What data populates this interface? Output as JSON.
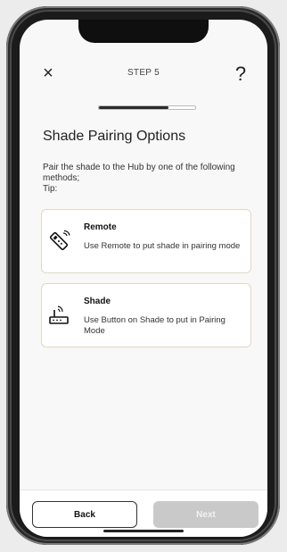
{
  "header": {
    "close_glyph": "×",
    "step_label": "STEP 5",
    "help_glyph": "?"
  },
  "progress": {
    "value": 0.72
  },
  "title": "Shade Pairing Options",
  "description": "Pair the shade to the Hub by one of the following methods;\nTip:",
  "options": [
    {
      "title": "Remote",
      "description": "Use Remote to put shade in pairing mode",
      "icon": "remote-icon"
    },
    {
      "title": "Shade",
      "description": "Use Button on Shade to put in Pairing Mode",
      "icon": "hub-button-icon"
    }
  ],
  "footer": {
    "back_label": "Back",
    "next_label": "Next"
  },
  "colors": {
    "card_border": "#e1d8c5",
    "next_disabled": "#c9c9c9"
  }
}
